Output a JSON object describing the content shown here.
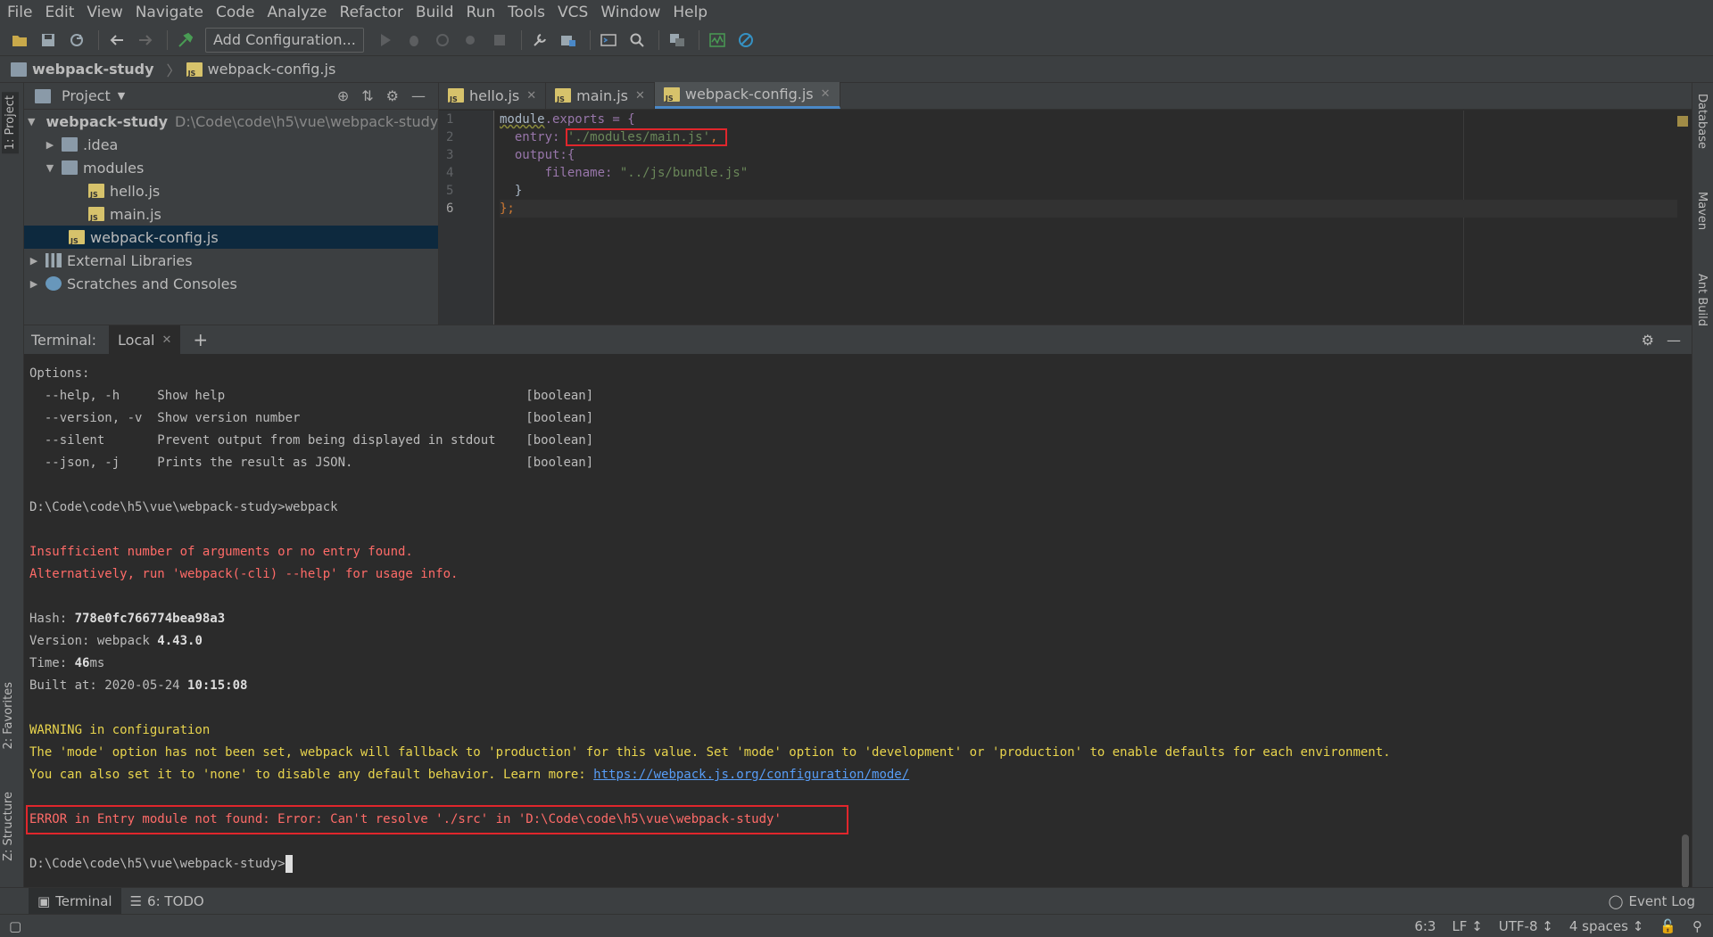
{
  "menu": [
    "File",
    "Edit",
    "View",
    "Navigate",
    "Code",
    "Analyze",
    "Refactor",
    "Build",
    "Run",
    "Tools",
    "VCS",
    "Window",
    "Help"
  ],
  "toolbar": {
    "add_config_label": "Add Configuration..."
  },
  "navbar": {
    "project": "webpack-study",
    "file": "webpack-config.js"
  },
  "left_stripe": {
    "project_tab": "1: Project",
    "favorites_tab": "2: Favorites",
    "structure_tab": "Z: Structure"
  },
  "right_stripe": {
    "database_tab": "Database",
    "maven_tab": "Maven",
    "ant_tab": "Ant Build"
  },
  "project_panel": {
    "title": "Project",
    "tree": [
      {
        "label": "webpack-study",
        "path": "D:\\Code\\code\\h5\\vue\\webpack-study"
      },
      {
        "label": ".idea"
      },
      {
        "label": "modules"
      },
      {
        "label": "hello.js"
      },
      {
        "label": "main.js"
      },
      {
        "label": "webpack-config.js"
      },
      {
        "label": "External Libraries"
      },
      {
        "label": "Scratches and Consoles"
      }
    ]
  },
  "editor": {
    "tabs": [
      {
        "label": "hello.js"
      },
      {
        "label": "main.js"
      },
      {
        "label": "webpack-config.js"
      }
    ],
    "line_numbers": [
      "1",
      "2",
      "3",
      "4",
      "5",
      "6"
    ],
    "code": {
      "l1_a": "module",
      "l1_b": ".exports = {",
      "l2_key": "  entry: ",
      "l2_val": "'./modules/main.js'",
      "l2_end": ",",
      "l3": "  output:{",
      "l4_key": "      filename: ",
      "l4_val": "\"../js/bundle.js\"",
      "l5": "  }",
      "l6": "};"
    }
  },
  "terminal": {
    "label": "Terminal:",
    "tab": "Local",
    "lines": {
      "t1": "Options:",
      "t2": "  --help, -h     Show help                                        [boolean]",
      "t3": "  --version, -v  Show version number                              [boolean]",
      "t4": "  --silent       Prevent output from being displayed in stdout    [boolean]",
      "t5": "  --json, -j     Prints the result as JSON.                       [boolean]",
      "t7": "D:\\Code\\code\\h5\\vue\\webpack-study>webpack",
      "t9": "Insufficient number of arguments or no entry found.",
      "t10": "Alternatively, run 'webpack(-cli) --help' for usage info.",
      "hash_label": "Hash: ",
      "hash_val": "778e0fc766774bea98a3",
      "version_label": "Version: webpack ",
      "version_val": "4.43.0",
      "time_label": "Time: ",
      "time_val": "46",
      "time_unit": "ms",
      "built_label": "Built at: 2020-05-24 ",
      "built_val": "10:15:08",
      "warn1": "WARNING in configuration",
      "warn2": "The 'mode' option has not been set, webpack will fallback to 'production' for this value. Set 'mode' option to 'development' or 'production' to enable defaults for each environment.",
      "warn3": "You can also set it to 'none' to disable any default behavior. Learn more: ",
      "warn_link": "https://webpack.js.org/configuration/mode/",
      "error": "ERROR in Entry module not found: Error: Can't resolve './src' in 'D:\\Code\\code\\h5\\vue\\webpack-study'",
      "prompt": "D:\\Code\\code\\h5\\vue\\webpack-study>"
    }
  },
  "bottom_tabs": {
    "terminal": "Terminal",
    "todo": "6: TODO",
    "event_log": "Event Log"
  },
  "status": {
    "position": "6:3",
    "line_sep": "LF ↕",
    "encoding": "UTF-8 ↕",
    "indent": "4 spaces ↕"
  }
}
